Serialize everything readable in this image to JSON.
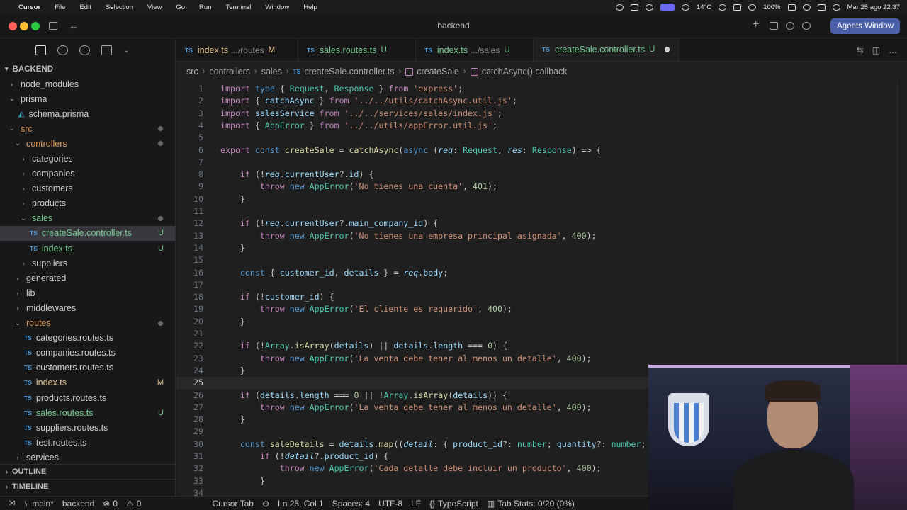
{
  "macbar": {
    "app": "Cursor",
    "menus": [
      "File",
      "Edit",
      "Selection",
      "View",
      "Go",
      "Run",
      "Terminal",
      "Window",
      "Help"
    ],
    "temp": "14°C",
    "battery": "100%",
    "datetime": "Mar 25 ago  22:37"
  },
  "titlebar": {
    "title": "backend",
    "agents_button": "Agents Window"
  },
  "explorer": {
    "root": "BACKEND",
    "items": [
      {
        "name": "node_modules",
        "depth": 1,
        "folder": true,
        "open": false
      },
      {
        "name": "prisma",
        "depth": 1,
        "folder": true,
        "open": true
      },
      {
        "name": "schema.prisma",
        "depth": 2,
        "folder": false,
        "icon": "prisma"
      },
      {
        "name": "src",
        "depth": 1,
        "folder": true,
        "open": true,
        "color": "o",
        "dot": true
      },
      {
        "name": "controllers",
        "depth": 2,
        "folder": true,
        "open": true,
        "color": "o",
        "dot": true
      },
      {
        "name": "categories",
        "depth": 3,
        "folder": true,
        "open": false
      },
      {
        "name": "companies",
        "depth": 3,
        "folder": true,
        "open": false
      },
      {
        "name": "customers",
        "depth": 3,
        "folder": true,
        "open": false
      },
      {
        "name": "products",
        "depth": 3,
        "folder": true,
        "open": false
      },
      {
        "name": "sales",
        "depth": 3,
        "folder": true,
        "open": true,
        "color": "u",
        "dot": true
      },
      {
        "name": "createSale.controller.ts",
        "depth": 4,
        "folder": false,
        "icon": "ts",
        "color": "u",
        "badge": "U",
        "selected": true
      },
      {
        "name": "index.ts",
        "depth": 4,
        "folder": false,
        "icon": "ts",
        "color": "u",
        "badge": "U"
      },
      {
        "name": "suppliers",
        "depth": 3,
        "folder": true,
        "open": false
      },
      {
        "name": "generated",
        "depth": 2,
        "folder": true,
        "open": false
      },
      {
        "name": "lib",
        "depth": 2,
        "folder": true,
        "open": false
      },
      {
        "name": "middlewares",
        "depth": 2,
        "folder": true,
        "open": false
      },
      {
        "name": "routes",
        "depth": 2,
        "folder": true,
        "open": true,
        "color": "o",
        "dot": true
      },
      {
        "name": "categories.routes.ts",
        "depth": 3,
        "folder": false,
        "icon": "ts"
      },
      {
        "name": "companies.routes.ts",
        "depth": 3,
        "folder": false,
        "icon": "ts"
      },
      {
        "name": "customers.routes.ts",
        "depth": 3,
        "folder": false,
        "icon": "ts"
      },
      {
        "name": "index.ts",
        "depth": 3,
        "folder": false,
        "icon": "ts",
        "color": "m",
        "badge": "M"
      },
      {
        "name": "products.routes.ts",
        "depth": 3,
        "folder": false,
        "icon": "ts"
      },
      {
        "name": "sales.routes.ts",
        "depth": 3,
        "folder": false,
        "icon": "ts",
        "color": "u",
        "badge": "U"
      },
      {
        "name": "suppliers.routes.ts",
        "depth": 3,
        "folder": false,
        "icon": "ts"
      },
      {
        "name": "test.routes.ts",
        "depth": 3,
        "folder": false,
        "icon": "ts"
      },
      {
        "name": "services",
        "depth": 2,
        "folder": true,
        "open": false
      }
    ],
    "outline": "OUTLINE",
    "timeline": "TIMELINE"
  },
  "tabs": [
    {
      "name": "index.ts",
      "sub": ".../routes",
      "status": "M"
    },
    {
      "name": "sales.routes.ts",
      "sub": "",
      "status": "U"
    },
    {
      "name": "index.ts",
      "sub": ".../sales",
      "status": "U"
    },
    {
      "name": "createSale.controller.ts",
      "sub": "",
      "status": "U",
      "active": true
    }
  ],
  "breadcrumb": [
    "src",
    "controllers",
    "sales",
    "createSale.controller.ts",
    "createSale",
    "catchAsync() callback"
  ],
  "code": {
    "current_line": 25,
    "lines": [
      "import type { Request, Response } from 'express';",
      "import { catchAsync } from '../../utils/catchAsync.util.js';",
      "import salesService from '../../services/sales/index.js';",
      "import { AppError } from '../../utils/appError.util.js';",
      "",
      "export const createSale = catchAsync(async (req: Request, res: Response) => {",
      "",
      "    if (!req.currentUser?.id) {",
      "        throw new AppError('No tienes una cuenta', 401);",
      "    }",
      "",
      "    if (!req.currentUser?.main_company_id) {",
      "        throw new AppError('No tienes una empresa principal asignada', 400);",
      "    }",
      "",
      "    const { customer_id, details } = req.body;",
      "",
      "    if (!customer_id) {",
      "        throw new AppError('El cliente es requerido', 400);",
      "    }",
      "",
      "    if (!Array.isArray(details) || details.length === 0) {",
      "        throw new AppError('La venta debe tener al menos un detalle', 400);",
      "    }",
      "",
      "    if (details.length === 0 || !Array.isArray(details)) {",
      "        throw new AppError('La venta debe tener al menos un detalle', 400);",
      "    }",
      "",
      "    const saleDetails = details.map((detail: { product_id?: number; quantity?: number;",
      "        if (!detail?.product_id) {",
      "            throw new AppError('Cada detalle debe incluir un producto', 400);",
      "        }",
      ""
    ]
  },
  "statusbar": {
    "branch": "main*",
    "folder": "backend",
    "errors": "0",
    "warnings": "0",
    "cursor_tab": "Cursor Tab",
    "position": "Ln 25, Col 1",
    "spaces": "Spaces: 4",
    "encoding": "UTF-8",
    "eol": "LF",
    "language": "TypeScript",
    "tab_stats": "Tab Stats: 0/20 (0%)"
  }
}
